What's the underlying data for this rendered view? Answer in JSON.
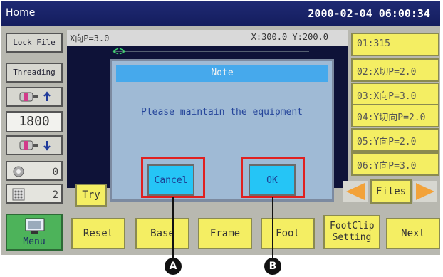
{
  "header": {
    "title": "Home",
    "datetime": "2000-02-04 06:00:34"
  },
  "sidebar": {
    "lock_file": "Lock File",
    "threading": "Threading",
    "speed_value": "1800",
    "bobbin_count": "0",
    "piece_count": "2",
    "menu": "Menu"
  },
  "workarea": {
    "left_readout": "X向P=3.0",
    "coords": "X:300.0 Y:200.0"
  },
  "right_list": [
    "01:315",
    "02:X切P=2.0",
    "03:X向P=3.0",
    "04:Y切向P=2.0",
    "05:Y向P=2.0",
    "06:Y向P=3.0"
  ],
  "controls": {
    "try": "Try",
    "files": "Files"
  },
  "bottom_bar": {
    "reset": "Reset",
    "base": "Base",
    "frame": "Frame",
    "foot": "Foot",
    "footclip_setting": "FootClip Setting",
    "next": "Next"
  },
  "dialog": {
    "title": "Note",
    "message": "Please maintain the equipment",
    "cancel": "Cancel",
    "ok": "OK"
  },
  "callouts": {
    "a": "A",
    "b": "B"
  },
  "colors": {
    "titlebar": "#1a2468",
    "yellow_button": "#f4ee63",
    "dialog_button": "#25c5f6",
    "highlight": "#e02020"
  }
}
